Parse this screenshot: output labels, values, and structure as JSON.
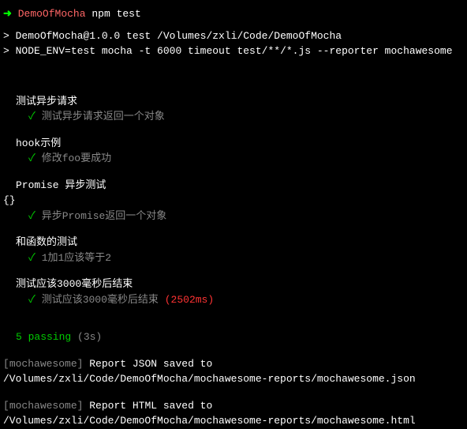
{
  "prompt": {
    "arrow": "➜",
    "dir": "DemoOfMocha",
    "command": "npm test"
  },
  "header": {
    "line1_prefix": "> ",
    "line1": "DemoOfMocha@1.0.0 test /Volumes/zxli/Code/DemoOfMocha",
    "line2_prefix": "> ",
    "line2": "NODE_ENV=test mocha -t 6000 timeout test/**/*.js --reporter mochawesome"
  },
  "suites": [
    {
      "title": "测试异步请求",
      "tests": [
        {
          "check": "✓",
          "name": "测试异步请求返回一个对象",
          "duration": ""
        }
      ]
    },
    {
      "title": "hook示例",
      "tests": [
        {
          "check": "✓",
          "name": "修改foo要成功",
          "duration": ""
        }
      ]
    },
    {
      "title": "Promise 异步测试",
      "extra": "{}",
      "tests": [
        {
          "check": "✓",
          "name": "异步Promise返回一个对象",
          "duration": ""
        }
      ]
    },
    {
      "title": "和函数的测试",
      "tests": [
        {
          "check": "✓",
          "name": "1加1应该等于2",
          "duration": ""
        }
      ]
    },
    {
      "title": "测试应该3000毫秒后结束",
      "tests": [
        {
          "check": "✓",
          "name": "测试应该3000毫秒后结束",
          "duration": "(2502ms)"
        }
      ]
    }
  ],
  "summary": {
    "passing": "5 passing",
    "time": "(3s)"
  },
  "reports": {
    "bracket_open": "[",
    "bracket_close": "]",
    "reporter": "mochawesome",
    "json_label": " Report JSON saved to ",
    "json_path": "/Volumes/zxli/Code/DemoOfMocha/mochawesome-reports/mochawesome.json",
    "html_label": " Report HTML saved to ",
    "html_path": "/Volumes/zxli/Code/DemoOfMocha/mochawesome-reports/mochawesome.html"
  }
}
